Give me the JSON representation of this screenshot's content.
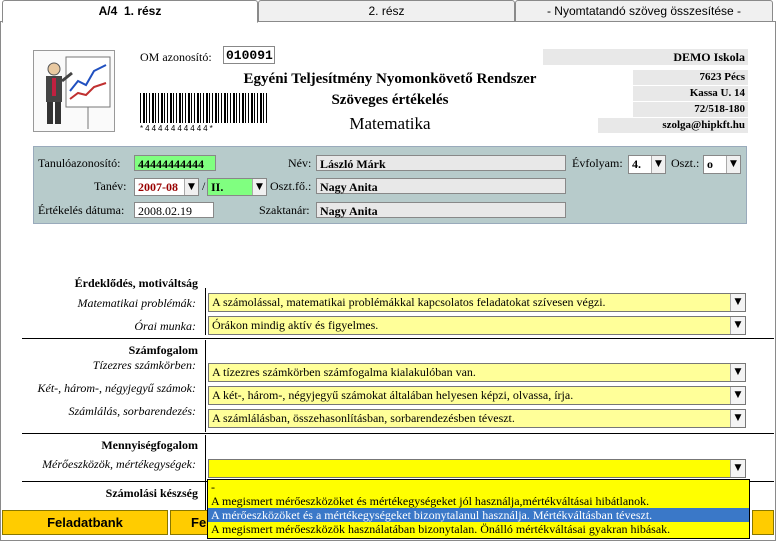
{
  "tabs": [
    {
      "code": "A/4",
      "label": "1. rész"
    },
    {
      "label": "2. rész"
    },
    {
      "label": "- Nyomtatandó szöveg összesítése -"
    }
  ],
  "header": {
    "om_label": "OM azonosító:",
    "om_value": "010091",
    "title1": "Egyéni Teljesítmény Nyomonkövető Rendszer",
    "title2": "Szöveges értékelés",
    "subject": "Matematika",
    "barcode_text": "*4444444444*"
  },
  "school": {
    "name": "DEMO Iskola",
    "city": "7623 Pécs",
    "street": "Kassa U. 14",
    "phone": "72/518-180",
    "email": "szolga@hipkft.hu"
  },
  "student": {
    "id_label": "Tanulóazonosító:",
    "id_value": "44444444444",
    "name_label": "Név:",
    "name_value": "László Márk",
    "year_label": "Tanév:",
    "year_value": "2007-08",
    "term_value": "II.",
    "head_label": "Oszt.fő.:",
    "head_value": "Nagy Anita",
    "date_label": "Értékelés dátuma:",
    "date_value": "2008.02.19",
    "teacher_label": "Szaktanár:",
    "teacher_value": "Nagy Anita",
    "grade_label": "Évfolyam:",
    "grade_value": "4.",
    "class_label": "Oszt.:",
    "class_value": "o"
  },
  "sections": {
    "s1_title": "Érdeklődés, motiváltság",
    "s1_r1_label": "Matematikai problémák:",
    "s1_r1_value": "A számolással, matematikai problémákkal kapcsolatos feladatokat szívesen végzi.",
    "s1_r2_label": "Órai munka:",
    "s1_r2_value": "Órákon mindig aktív és figyelmes.",
    "s2_title": "Számfogalom",
    "s2_r1_label": "Tízezres számkörben:",
    "s2_r1_value": "A tízezres számkörben számfogalma kialakulóban van.",
    "s2_r2_label": "Két-, három-, négyjegyű számok:",
    "s2_r2_value": "A két-, három-, négyjegyű számokat általában helyesen képzi, olvassa, írja.",
    "s2_r3_label": "Számlálás, sorbarendezés:",
    "s2_r3_value": "A számlálásban, összehasonlításban, sorbarendezésben téveszt.",
    "s3_title": "Mennyiségfogalom",
    "s3_r1_label": "Mérőeszközök, mértékegységek:",
    "s3_r1_value": "",
    "s4_title": "Számolási készség"
  },
  "dropdown": {
    "options": [
      "-",
      "A megismert mérőeszközöket és mértékegységeket jól használja,mértékváltásai hibátlanok.",
      "A mérőeszközöket és a mértékegységeket bizonytalanul használja. Mértékváltásban téveszt.",
      "A megismert mérőeszközök használatában bizonytalan. Önálló mértékváltásai gyakran hibásak."
    ]
  },
  "bottom": {
    "btn1": "Feladatbank",
    "btn2": "Fe"
  },
  "colors": {
    "accent": "#ffcc00",
    "field": "#ffff99",
    "panel": "#b7cbcb",
    "selected": "#3a78c8"
  }
}
